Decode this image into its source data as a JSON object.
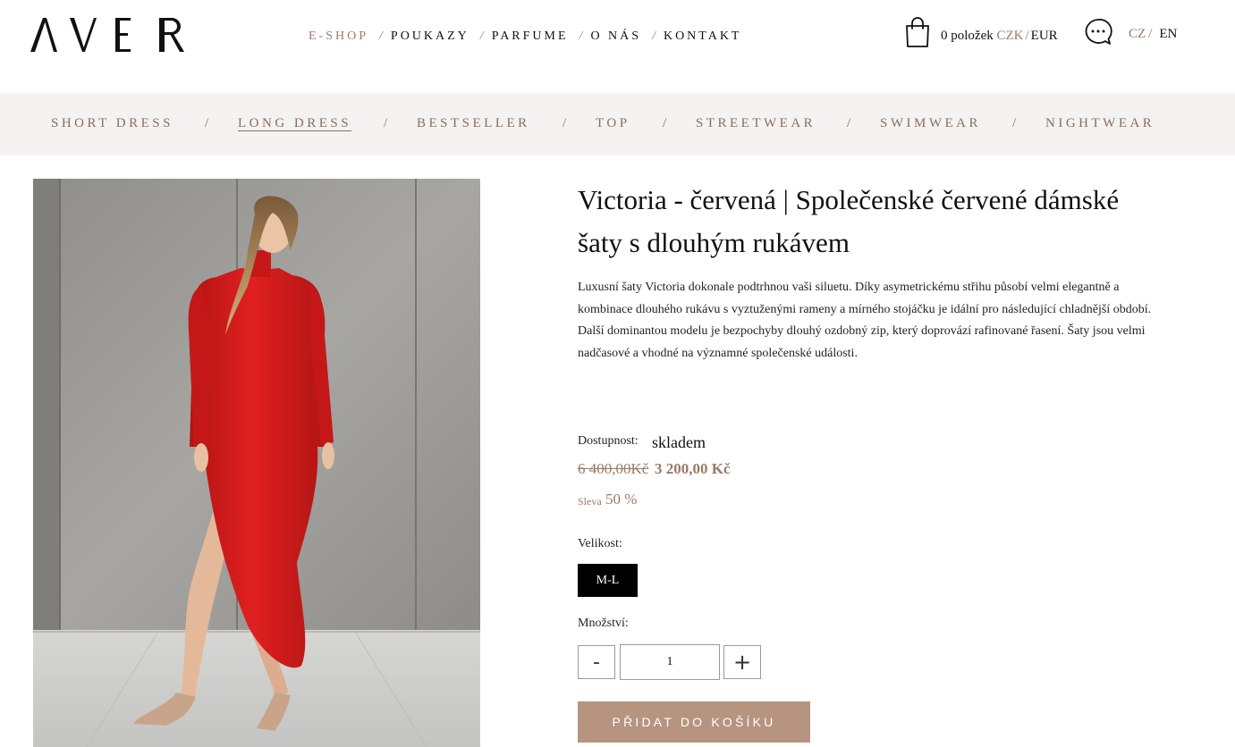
{
  "brand": {
    "logo_text": "AVER"
  },
  "header": {
    "nav": [
      {
        "label": "E-SHOP",
        "active": true
      },
      {
        "label": "POUKAZY",
        "active": false
      },
      {
        "label": "PARFUME",
        "active": false
      },
      {
        "label": "O NÁS",
        "active": false
      },
      {
        "label": "KONTAKT",
        "active": false
      }
    ],
    "nav_separator": "/",
    "cart": {
      "icon": "shopping-bag-icon",
      "items_text": "0 položek",
      "currency_active": "CZK",
      "currency_other": "EUR",
      "currency_separator": "/"
    },
    "chat": {
      "icon": "chat-bubble-icon"
    },
    "language": {
      "active": "CZ",
      "other": "EN",
      "separator": "/"
    }
  },
  "categories": [
    {
      "label": "SHORT DRESS",
      "active": false
    },
    {
      "label": "LONG DRESS",
      "active": true
    },
    {
      "label": "BESTSELLER",
      "active": false
    },
    {
      "label": "TOP",
      "active": false
    },
    {
      "label": "STREETWEAR",
      "active": false
    },
    {
      "label": "SWIMWEAR",
      "active": false
    },
    {
      "label": "NIGHTWEAR",
      "active": false
    }
  ],
  "category_separator": "/",
  "product": {
    "title_line1": "Victoria - červená | Společenské červené dámské",
    "title_line2": "šaty s dlouhým rukávem",
    "description_lines": [
      "Luxusní šaty Victoria dokonale podtrhnou vaši siluetu.  Díky asymetrickému střihu působí velmi elegantně a",
      "kombinace dlouhého rukávu s vyztuženými rameny a mírného stojáčku je idální pro následující chladnější období.",
      "Další dominantou modelu je bezpochyby dlouhý ozdobný zip, který doprovází rafinované řasení. Šaty jsou velmi",
      "nadčasové a vhodné na významné společenské události."
    ],
    "availability_label": "Dostupnost:",
    "availability_value": "skladem",
    "price_old": "6 400,00Kč",
    "price_new": "3 200,00 Kč",
    "discount_label": "Sleva",
    "discount_value": "50 %",
    "size_label": "Velikost:",
    "sizes": [
      "M-L"
    ],
    "selected_size": "M-L",
    "quantity_label": "Množství:",
    "quantity": "1",
    "qty_minus": "-",
    "qty_plus": "+",
    "add_to_cart_label": "PŘIDAT DO KOŠÍKU"
  },
  "colors": {
    "accent": "#9a7a65",
    "button": "#b79480",
    "category_bar": "#f4f3f1",
    "dress": "#d81e1e"
  }
}
